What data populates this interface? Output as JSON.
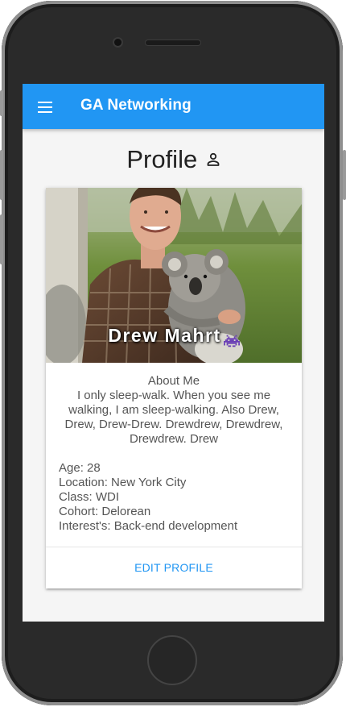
{
  "app": {
    "title": "GA Networking",
    "menu_icon": "hamburger-menu-icon"
  },
  "page": {
    "title": "Profile",
    "title_icon": "person-icon"
  },
  "profile": {
    "name_first": "Drew",
    "name_last": "Mahrt",
    "name_emoji": "👾",
    "photo": "photo of man holding a koala",
    "about_heading": "About Me",
    "about_text": "I only sleep-walk. When you see me walking, I am sleep-walking. Also Drew, Drew, Drew-Drew. Drewdrew, Drewdrew, Drewdrew. Drew",
    "details": [
      "Age: 28",
      "Location: New York City",
      "Class: WDI",
      "Cohort: Delorean",
      "Interest's: Back-end development"
    ]
  },
  "actions": {
    "edit_label": "EDIT PROFILE"
  },
  "colors": {
    "primary": "#2196f3",
    "screen_bg": "#f5f5f5",
    "frame": "#2a2a2a"
  }
}
